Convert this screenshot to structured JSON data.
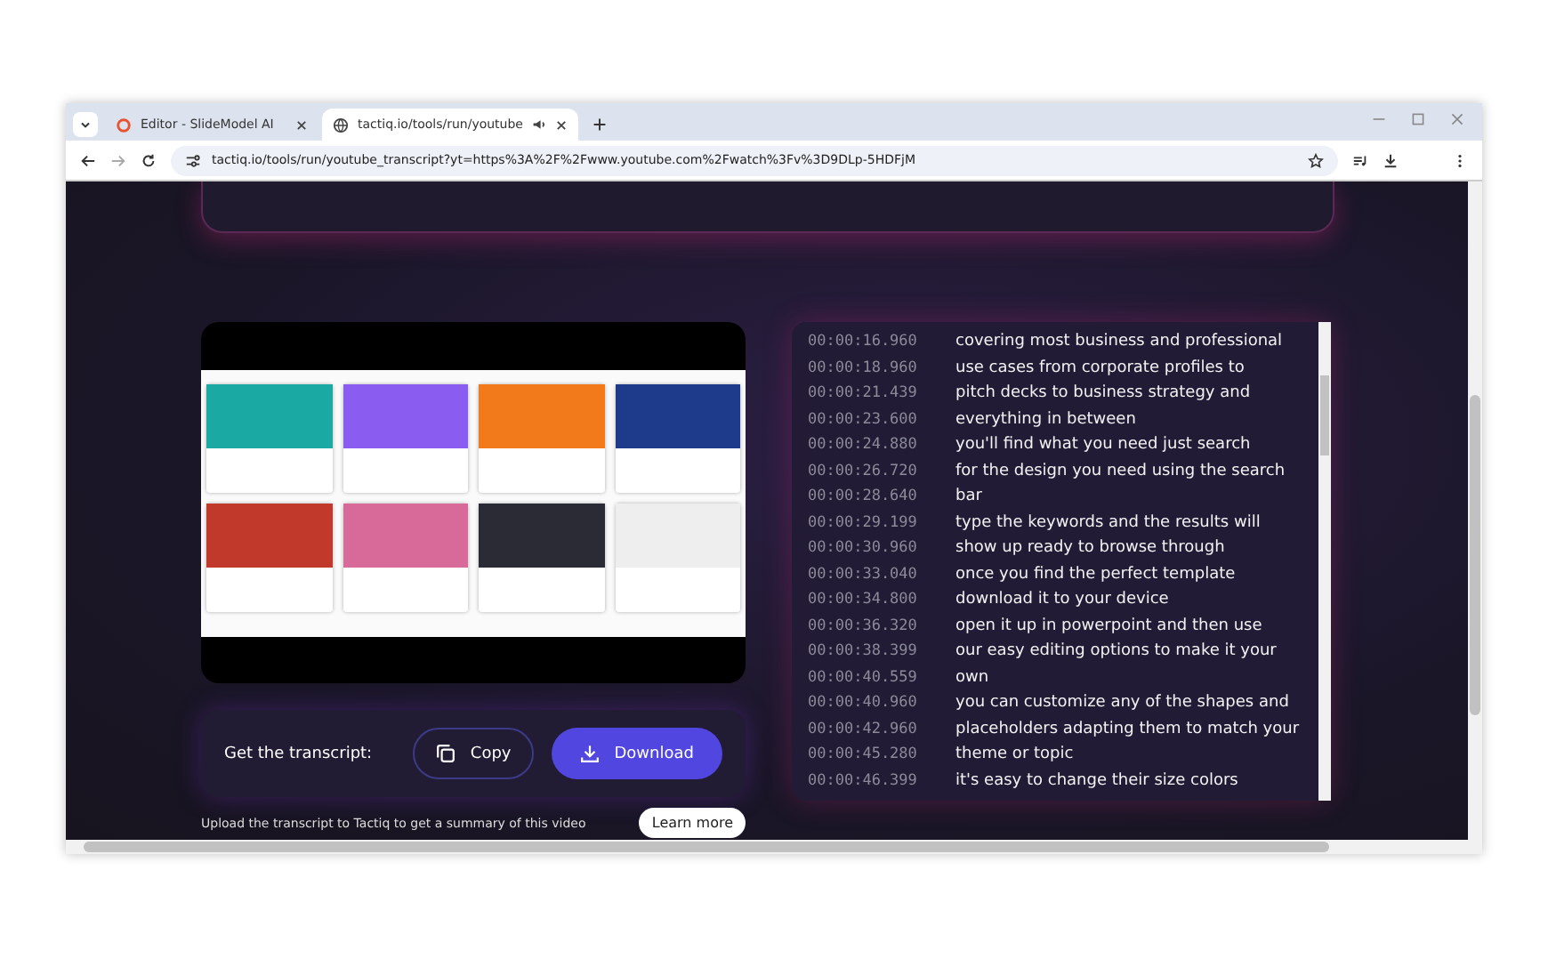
{
  "browser": {
    "tabs": [
      {
        "title": "Editor - SlideModel AI",
        "selected": false
      },
      {
        "title": "tactiq.io/tools/run/youtube",
        "selected": true
      }
    ],
    "url": "tactiq.io/tools/run/youtube_transcript?yt=https%3A%2F%2Fwww.youtube.com%2Fwatch%3Fv%3D9DLp-5HDFjM"
  },
  "transcript_actions": {
    "label": "Get the transcript:",
    "buttons": [
      {
        "label": "Copy",
        "kind": "outline"
      },
      {
        "label": "Download",
        "kind": "primary"
      }
    ]
  },
  "transcript": [
    {
      "time": "00:00:16.960",
      "text": "covering most business and professional"
    },
    {
      "time": "00:00:18.960",
      "text": "use cases from corporate profiles to"
    },
    {
      "time": "00:00:21.439",
      "text": "pitch decks to business strategy and"
    },
    {
      "time": "00:00:23.600",
      "text": "everything in between"
    },
    {
      "time": "00:00:24.880",
      "text": "you'll find what you need just search"
    },
    {
      "time": "00:00:26.720",
      "text": "for the design you need using the search"
    },
    {
      "time": "00:00:28.640",
      "text": "bar"
    },
    {
      "time": "00:00:29.199",
      "text": "type the keywords and the results will"
    },
    {
      "time": "00:00:30.960",
      "text": "show up ready to browse through"
    },
    {
      "time": "00:00:33.040",
      "text": "once you find the perfect template"
    },
    {
      "time": "00:00:34.800",
      "text": "download it to your device"
    },
    {
      "time": "00:00:36.320",
      "text": "open it up in powerpoint and then use"
    },
    {
      "time": "00:00:38.399",
      "text": "our easy editing options to make it your"
    },
    {
      "time": "00:00:40.559",
      "text": "own"
    },
    {
      "time": "00:00:40.960",
      "text": "you can customize any of the shapes and"
    },
    {
      "time": "00:00:42.960",
      "text": "placeholders adapting them to match your"
    },
    {
      "time": "00:00:45.280",
      "text": "theme or topic"
    },
    {
      "time": "00:00:46.399",
      "text": "it's easy to change their size colors"
    }
  ],
  "upload": {
    "text": "Upload the transcript to Tactiq to get a summary of this video",
    "button": "Learn more"
  }
}
